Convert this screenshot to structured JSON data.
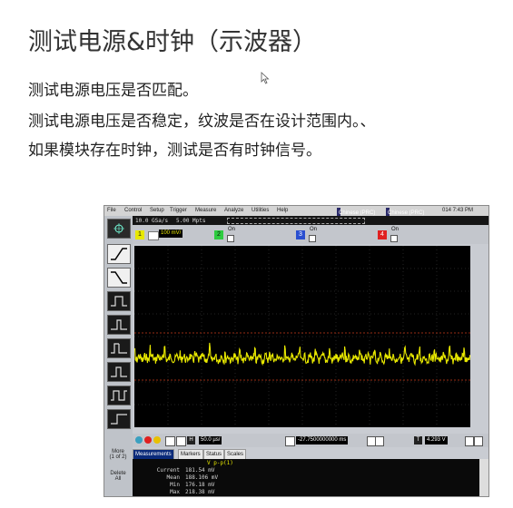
{
  "slide": {
    "title": "测试电源&时钟（示波器）",
    "bullets": [
      "测试电源电压是否匹配。",
      "测试电源电压是否稳定，纹波是否在设计范围内。、",
      "如果模块存在时钟，测试是否有时钟信号。"
    ]
  },
  "scope": {
    "menu": [
      "File",
      "Control",
      "Setup",
      "Trigger",
      "Measure",
      "Analyze",
      "Utilities",
      "Help"
    ],
    "lang1": "Chinese (PRC)",
    "lang2": "Chinese (PRC)",
    "clock": "014  7:43 PM",
    "sample_rate": "10.0 GSa/s",
    "points": "5.00 Mpts",
    "channels": [
      {
        "num": "1",
        "value": "100 mV/",
        "color": "#e8e800"
      },
      {
        "num": "2",
        "value": "On",
        "color": "#2ecc40"
      },
      {
        "num": "3",
        "value": "On",
        "color": "#2a4fd0"
      },
      {
        "num": "4",
        "value": "On",
        "color": "#e02020"
      }
    ],
    "timebase": "50.0 µs/",
    "delay": "-27.7500000000 ms",
    "trigger_level": "4.293 V",
    "more_label": "More",
    "more_sub": "(1 of 2)",
    "delete_label": "Delete",
    "all_label": "All",
    "tabs": [
      "Measurements",
      "Markers",
      "Status",
      "Scales"
    ],
    "meas_header": "V p-p(1)",
    "measurements": [
      {
        "label": "Current",
        "value": "181.54 mV"
      },
      {
        "label": "Mean",
        "value": "188.106 mV"
      },
      {
        "label": "Min",
        "value": "176.18 mV"
      },
      {
        "label": "Max",
        "value": "218.38 mV"
      }
    ],
    "colors": {
      "trace": "#e8e800",
      "ref": "#c83a1a",
      "grid": "#5a5a5a"
    }
  }
}
